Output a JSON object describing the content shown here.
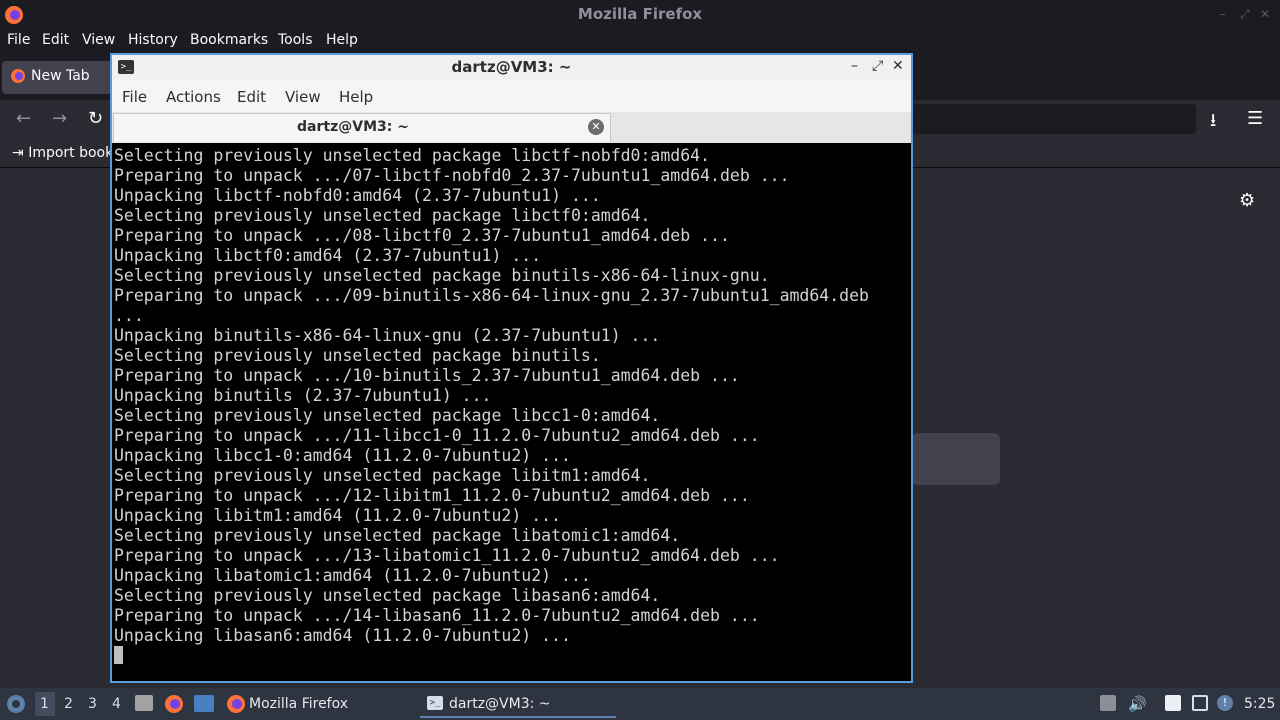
{
  "firefox": {
    "window_title": "Mozilla Firefox",
    "menu": [
      "File",
      "Edit",
      "View",
      "History",
      "Bookmarks",
      "Tools",
      "Help"
    ],
    "tab_label": "New Tab",
    "bookmark_import_label": "Import book"
  },
  "terminal": {
    "window_title": "dartz@VM3: ~",
    "menu": [
      "File",
      "Actions",
      "Edit",
      "View",
      "Help"
    ],
    "tab_label": "dartz@VM3: ~",
    "lines": [
      "Selecting previously unselected package libctf-nobfd0:amd64.",
      "Preparing to unpack .../07-libctf-nobfd0_2.37-7ubuntu1_amd64.deb ...",
      "Unpacking libctf-nobfd0:amd64 (2.37-7ubuntu1) ...",
      "Selecting previously unselected package libctf0:amd64.",
      "Preparing to unpack .../08-libctf0_2.37-7ubuntu1_amd64.deb ...",
      "Unpacking libctf0:amd64 (2.37-7ubuntu1) ...",
      "Selecting previously unselected package binutils-x86-64-linux-gnu.",
      "Preparing to unpack .../09-binutils-x86-64-linux-gnu_2.37-7ubuntu1_amd64.deb",
      "...",
      "Unpacking binutils-x86-64-linux-gnu (2.37-7ubuntu1) ...",
      "Selecting previously unselected package binutils.",
      "Preparing to unpack .../10-binutils_2.37-7ubuntu1_amd64.deb ...",
      "Unpacking binutils (2.37-7ubuntu1) ...",
      "Selecting previously unselected package libcc1-0:amd64.",
      "Preparing to unpack .../11-libcc1-0_11.2.0-7ubuntu2_amd64.deb ...",
      "Unpacking libcc1-0:amd64 (11.2.0-7ubuntu2) ...",
      "Selecting previously unselected package libitm1:amd64.",
      "Preparing to unpack .../12-libitm1_11.2.0-7ubuntu2_amd64.deb ...",
      "Unpacking libitm1:amd64 (11.2.0-7ubuntu2) ...",
      "Selecting previously unselected package libatomic1:amd64.",
      "Preparing to unpack .../13-libatomic1_11.2.0-7ubuntu2_amd64.deb ...",
      "Unpacking libatomic1:amd64 (11.2.0-7ubuntu2) ...",
      "Selecting previously unselected package libasan6:amd64.",
      "Preparing to unpack .../14-libasan6_11.2.0-7ubuntu2_amd64.deb ...",
      "Unpacking libasan6:amd64 (11.2.0-7ubuntu2) ..."
    ]
  },
  "taskbar": {
    "workspaces": [
      "1",
      "2",
      "3",
      "4"
    ],
    "tasks": [
      "Mozilla Firefox",
      "dartz@VM3: ~"
    ],
    "clock": "5:25"
  },
  "colors": {
    "firefox_chrome": "#1c1b22",
    "terminal_border": "#5a9be0",
    "taskbar": "#2e3440"
  }
}
